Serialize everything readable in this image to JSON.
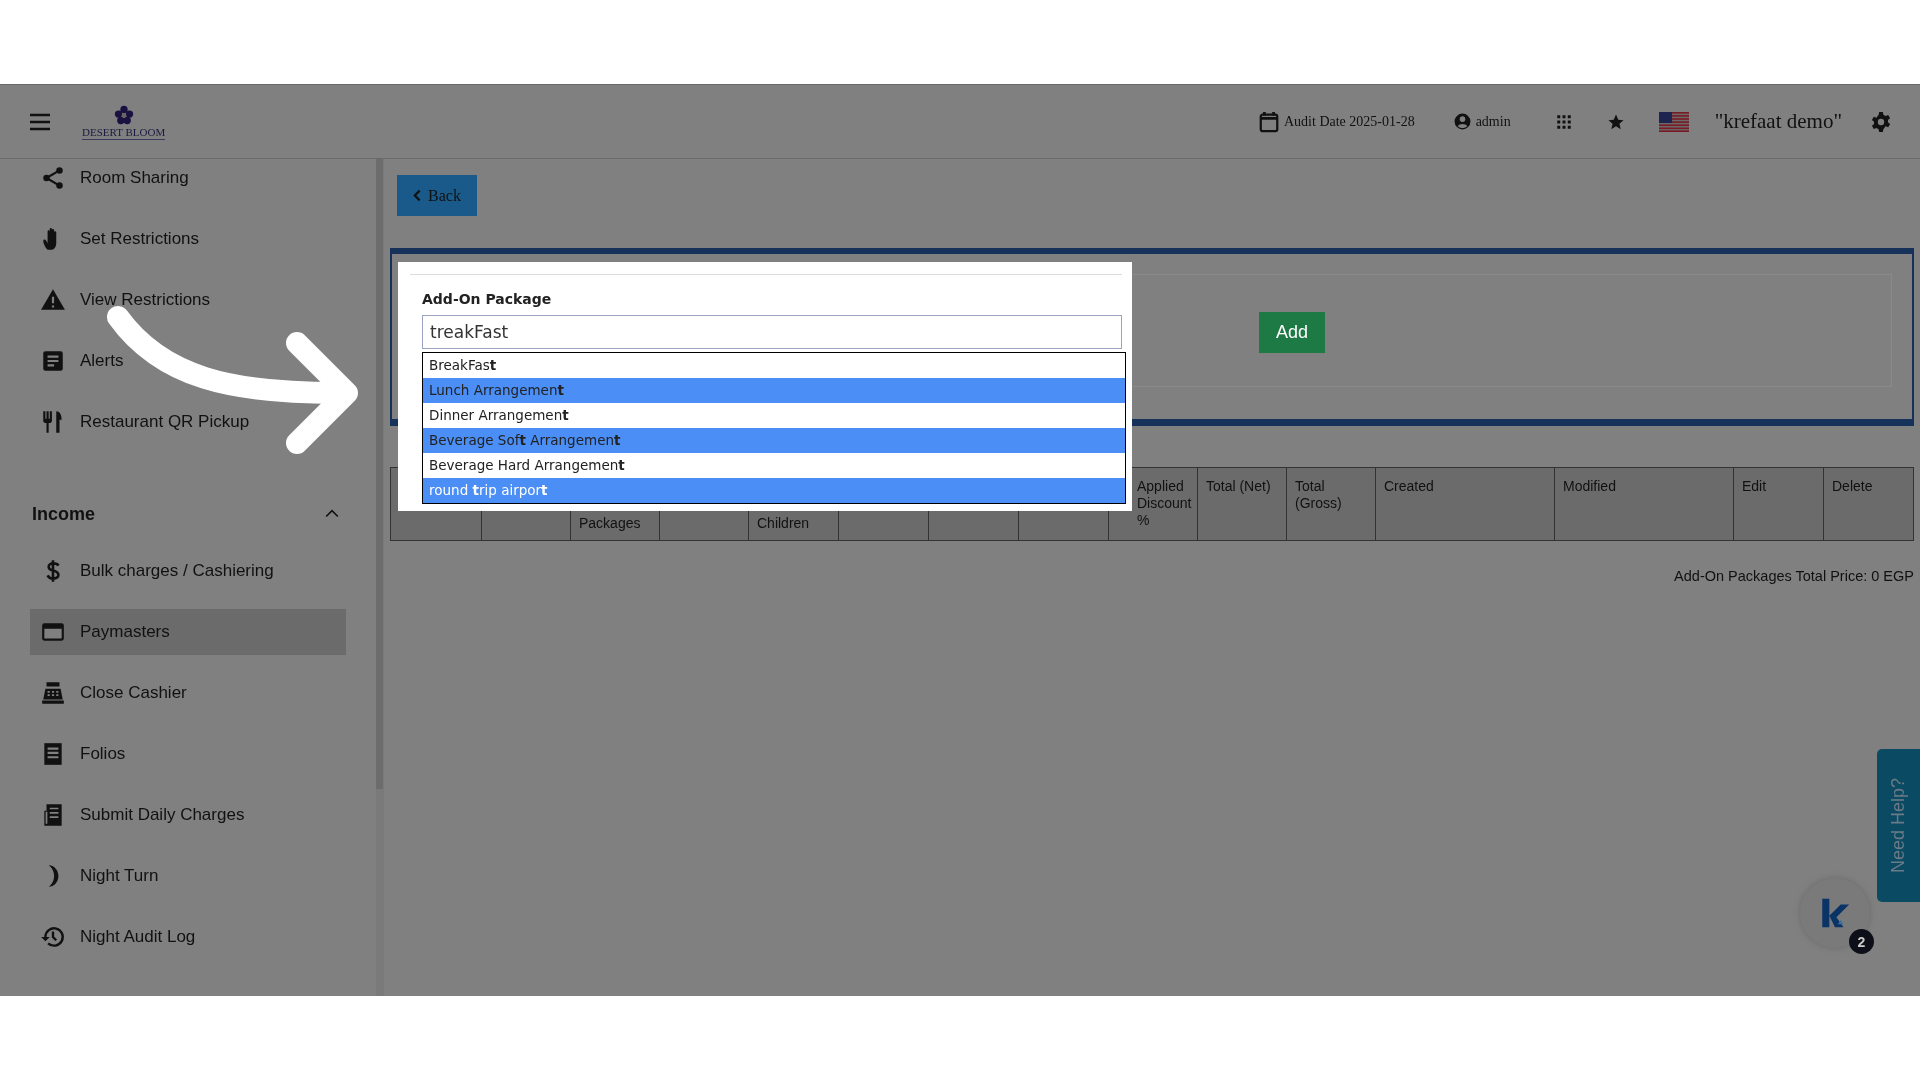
{
  "header": {
    "logo_text": "DESERT BLOOM",
    "audit_date": "Audit Date 2025-01-28",
    "user": "admin",
    "profile": "\"krefaat demo\""
  },
  "sidebar": {
    "items": [
      {
        "label": "Room Sharing",
        "selected": false
      },
      {
        "label": "Set Restrictions",
        "selected": false
      },
      {
        "label": "View Restrictions",
        "selected": false
      },
      {
        "label": "Alerts",
        "selected": false
      },
      {
        "label": "Restaurant QR Pickup",
        "selected": false
      }
    ],
    "section": {
      "title": "Income",
      "expanded": true,
      "items": [
        {
          "label": "Bulk charges / Cashiering",
          "selected": false
        },
        {
          "label": "Paymasters",
          "selected": true
        },
        {
          "label": "Close Cashier",
          "selected": false
        },
        {
          "label": "Folios",
          "selected": false
        },
        {
          "label": "Submit Daily Charges",
          "selected": false
        },
        {
          "label": "Night Turn",
          "selected": false
        },
        {
          "label": "Night Audit Log",
          "selected": false
        }
      ]
    }
  },
  "back_button": "Back",
  "add_button": "Add",
  "addon_field": {
    "label": "Add-On Package",
    "value": "treakFast",
    "suggestions": [
      {
        "text": "BreakFas**t**",
        "highlighted": false,
        "selected": false
      },
      {
        "text": "Lunch Arrangemen**t**",
        "highlighted": true,
        "selected": false
      },
      {
        "text": "Dinner Arrangemen**t**",
        "highlighted": false,
        "selected": false
      },
      {
        "text": "Beverage Sof**t** Arrangemen**t**",
        "highlighted": true,
        "selected": false
      },
      {
        "text": "Beverage Hard Arrangemen**t**",
        "highlighted": false,
        "selected": false
      },
      {
        "text": "round **t**rip airpor**t**",
        "highlighted": true,
        "selected": true
      }
    ]
  },
  "table": {
    "columns": [
      {},
      {},
      {
        "label": "Packages"
      },
      {},
      {
        "label": "Children"
      },
      {},
      {},
      {},
      {
        "label": "Applied Discount %"
      },
      {
        "label": "Total (Net)"
      },
      {
        "label": "Total (Gross)"
      },
      {
        "label": "Created"
      },
      {
        "label": "Modified"
      },
      {
        "label": "Edit"
      },
      {
        "label": "Delete"
      }
    ]
  },
  "total": "Add-On Packages Total Price: 0 EGP",
  "help_tab": "Need Help?",
  "chat_badge": "2"
}
